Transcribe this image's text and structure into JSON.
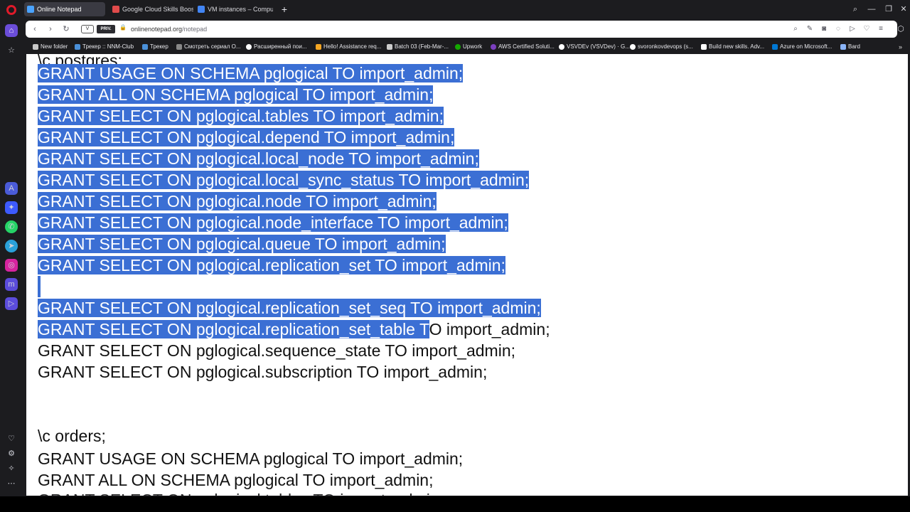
{
  "tabs": [
    {
      "title": "Online Notepad",
      "active": true,
      "favicon_color": "#4aa3ff"
    },
    {
      "title": "Google Cloud Skills Boost",
      "active": false,
      "favicon_color": "#e04b4b"
    },
    {
      "title": "VM instances – Compute",
      "active": false,
      "favicon_color": "#4285f4"
    }
  ],
  "new_tab_glyph": "+",
  "window_controls": {
    "search": "⌕",
    "minimize": "—",
    "restore": "❐",
    "close": "✕"
  },
  "address": {
    "vpn": "V",
    "private_badge": "PRIV.",
    "url_host": "onlinenotepad.org",
    "url_path": "/notepad"
  },
  "bookmarks": [
    {
      "label": "New folder",
      "icon_color": "#c8c8c8"
    },
    {
      "label": "Трекер :: NNM-Club",
      "icon_color": "#4a90d9"
    },
    {
      "label": "Трекер",
      "icon_color": "#4a90d9"
    },
    {
      "label": "Смотреть сериал О...",
      "icon_color": "#888888"
    },
    {
      "label": "Расширенный пои...",
      "icon_color": "#ffffff"
    },
    {
      "label": "Hello! Assistance req...",
      "icon_color": "#f5a623"
    },
    {
      "label": "Batch 03 (Feb-Mar-...",
      "icon_color": "#cccccc"
    },
    {
      "label": "Upwork",
      "icon_color": "#14a800"
    },
    {
      "label": "AWS Certified Soluti...",
      "icon_color": "#7b3fbf"
    },
    {
      "label": "VSVDEv (VSVDev) · G...",
      "icon_color": "#ffffff"
    },
    {
      "label": "svoronkovdevops (s...",
      "icon_color": "#ffffff"
    },
    {
      "label": "Build new skills. Adv...",
      "icon_color": "#ffffff"
    },
    {
      "label": "Azure on Microsoft...",
      "icon_color": "#0078d4"
    },
    {
      "label": "Bard",
      "icon_color": "#8ab4f8"
    }
  ],
  "bookmarks_more": "»",
  "notepad": {
    "top_partial": "\\c postgres;",
    "lines": [
      "GRANT USAGE ON SCHEMA pglogical TO import_admin;",
      "GRANT ALL ON SCHEMA pglogical TO import_admin;",
      "GRANT SELECT ON pglogical.tables TO import_admin;",
      "GRANT SELECT ON pglogical.depend TO import_admin;",
      "GRANT SELECT ON pglogical.local_node TO import_admin;",
      "GRANT SELECT ON pglogical.local_sync_status TO import_admin;",
      "GRANT SELECT ON pglogical.node TO import_admin;",
      "GRANT SELECT ON pglogical.node_interface TO import_admin;",
      "GRANT SELECT ON pglogical.queue TO import_admin;",
      "GRANT SELECT ON pglogical.replication_set TO import_admin;",
      "",
      "GRANT SELECT ON pglogical.replication_set_seq TO import_admin;"
    ],
    "partial_line_selected": "GRANT SELECT ON pglogical.replication_set_table T",
    "partial_line_rest": "O import_admin;",
    "after_lines": [
      "GRANT SELECT ON pglogical.sequence_state TO import_admin;",
      "GRANT SELECT ON pglogical.subscription TO import_admin;"
    ],
    "orders_header": "\\c orders;",
    "orders_lines": [
      "GRANT USAGE ON SCHEMA pglogical TO import_admin;",
      "GRANT ALL ON SCHEMA pglogical TO import_admin;"
    ],
    "bottom_partial": "GRANT SELECT ON pglogical.tables TO import_admin;"
  },
  "colors": {
    "selection": "#3b6fd4",
    "sidebar_accent": "#6b4dd8",
    "opera_red": "#e01a2a"
  }
}
